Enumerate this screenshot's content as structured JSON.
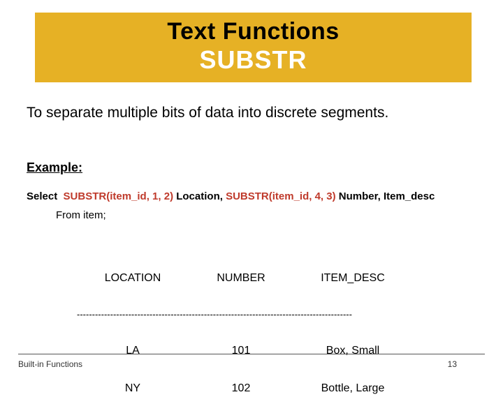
{
  "banner": {
    "line1": "Text Functions",
    "line2": "SUBSTR"
  },
  "desc": "To separate multiple bits of data into discrete segments.",
  "example_label": "Example:",
  "query": {
    "select_kw": "Select  ",
    "p1": "SUBSTR(item_id, 1, 2)",
    "t1": " Location, ",
    "p2": "SUBSTR(item_id, 4, 3)",
    "t2": " Number, Item_desc",
    "from_kw": "From",
    "from_rest": " item;"
  },
  "result": {
    "headers": [
      "LOCATION",
      "NUMBER",
      "ITEM_DESC"
    ],
    "sep": "-------------------------------------------------------------------------------------------",
    "rows": [
      {
        "c0": "LA",
        "c1": "101",
        "c2": "Box, Small"
      },
      {
        "c0": "NY",
        "c1": "102",
        "c2": "Bottle, Large"
      }
    ]
  },
  "footer": {
    "left": "Built-in Functions",
    "page": "13"
  },
  "chart_data": {
    "type": "table",
    "title": "SUBSTR example output",
    "columns": [
      "LOCATION",
      "NUMBER",
      "ITEM_DESC"
    ],
    "rows": [
      [
        "LA",
        "101",
        "Box, Small"
      ],
      [
        "NY",
        "102",
        "Bottle, Large"
      ]
    ]
  }
}
